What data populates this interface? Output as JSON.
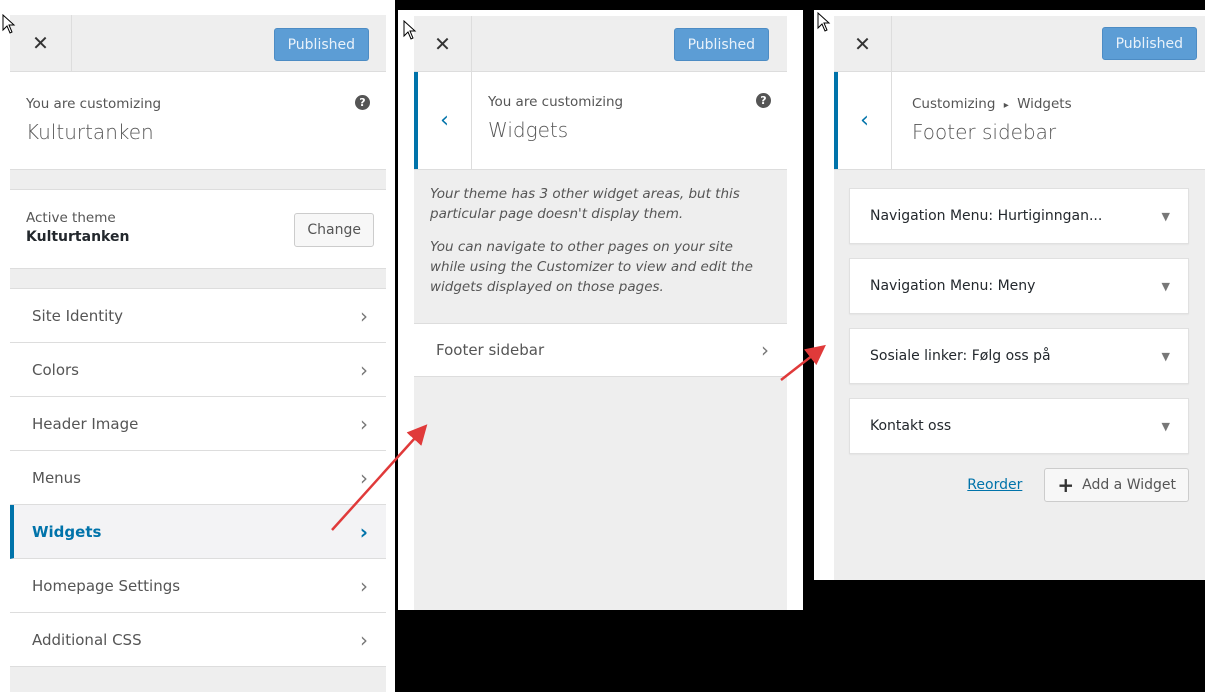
{
  "panel1": {
    "publish_label": "Published",
    "customizing_label": "You are customizing",
    "site_name": "Kulturtanken",
    "active_theme_label": "Active theme",
    "active_theme_name": "Kulturtanken",
    "change_label": "Change",
    "menu": [
      {
        "label": "Site Identity"
      },
      {
        "label": "Colors"
      },
      {
        "label": "Header Image"
      },
      {
        "label": "Menus"
      },
      {
        "label": "Widgets"
      },
      {
        "label": "Homepage Settings"
      },
      {
        "label": "Additional CSS"
      }
    ]
  },
  "panel2": {
    "publish_label": "Published",
    "customizing_label": "You are customizing",
    "section_title": "Widgets",
    "desc1": "Your theme has 3 other widget areas, but this particular page doesn't display them.",
    "desc2": "You can navigate to other pages on your site while using the Customizer to view and edit the widgets displayed on those pages.",
    "area_label": "Footer sidebar"
  },
  "panel3": {
    "publish_label": "Published",
    "breadcrumb_root": "Customizing",
    "breadcrumb_sep": "▸",
    "breadcrumb_section": "Widgets",
    "area_title": "Footer sidebar",
    "widgets": [
      {
        "label": "Navigation Menu: Hurtiginngan..."
      },
      {
        "label": "Navigation Menu: Meny"
      },
      {
        "label": "Sosiale linker: Følg oss på"
      },
      {
        "label": "Kontakt oss"
      }
    ],
    "reorder_label": "Reorder",
    "add_widget_label": "Add a Widget"
  },
  "colors": {
    "accent": "#0073aa",
    "publish": "#5c9dd5",
    "arrow": "#e03a3a"
  }
}
